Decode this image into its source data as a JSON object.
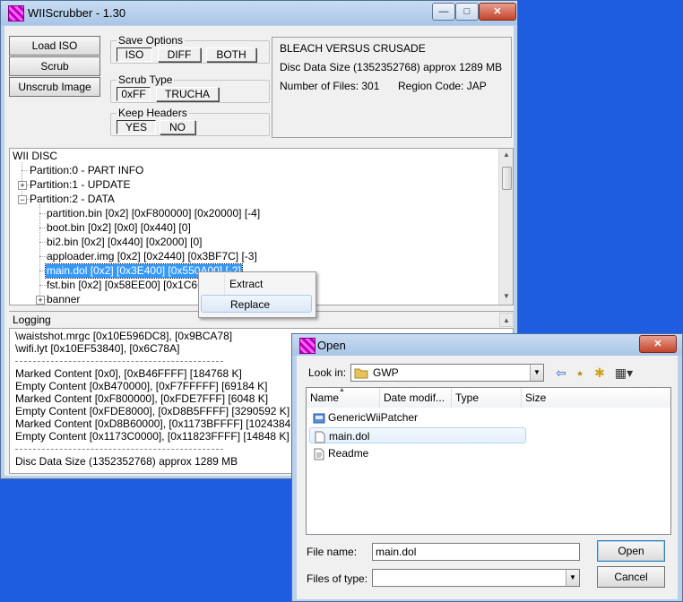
{
  "main_window": {
    "title": "WIIScrubber - 1.30",
    "buttons": {
      "load_iso": "Load ISO",
      "scrub": "Scrub",
      "unscrub": "Unscrub Image"
    },
    "save_options": {
      "legend": "Save Options",
      "iso": "ISO",
      "diff": "DIFF",
      "both": "BOTH",
      "selected": "ISO"
    },
    "scrub_type": {
      "legend": "Scrub Type",
      "ff": "0xFF",
      "trucha": "TRUCHA",
      "selected": "0xFF"
    },
    "keep_headers": {
      "legend": "Keep Headers",
      "yes": "YES",
      "no": "NO",
      "selected": "YES"
    },
    "info": {
      "game_title": "BLEACH VERSUS CRUSADE",
      "disc_size": "Disc Data Size (1352352768) approx  1289 MB",
      "num_files": "Number of Files: 301",
      "region": "Region Code: JAP"
    },
    "tree": {
      "root": "WII DISC",
      "items": [
        "Partition:0 - PART INFO",
        "Partition:1 - UPDATE",
        "Partition:2 - DATA",
        "partition.bin [0x2] [0xF800000] [0x20000] [-4]",
        "boot.bin [0x2] [0x0] [0x440] [0]",
        "bi2.bin [0x2] [0x440] [0x2000] [0]",
        "apploader.img [0x2] [0x2440] [0x3BF7C] [-3]",
        "main.dol [0x2] [0x3E400] [0x550A00] [-2]",
        "fst.bin [0x2] [0x58EE00] [0x1C6C] [-1]",
        "banner"
      ]
    },
    "logging": {
      "label": "Logging",
      "lines": [
        "\\waistshot.mrgc [0x10E596DC8], [0x9BCA78]",
        "\\wifi.lyt [0x10EF53840], [0x6C78A]",
        "Marked Content [0x0], [0xB46FFFF] [184768 K]",
        "Empty Content [0xB470000], [0xF7FFFFF] [69184 K]",
        "Marked Content [0xF800000], [0xFDE7FFF] [6048 K]",
        "Empty Content [0xFDE8000], [0xD8B5FFFF] [3290592 K]",
        "Marked Content [0xD8B60000], [0x1173BFFFF] [1024384 K]",
        "Empty Content [0x1173C0000], [0x11823FFFF] [14848 K]",
        "Disc Data Size (1352352768) approx  1289 MB"
      ]
    }
  },
  "context_menu": {
    "items": [
      "Extract",
      "Replace"
    ],
    "highlighted": "Replace"
  },
  "open_dialog": {
    "title": "Open",
    "look_in_label": "Look in:",
    "look_in_value": "GWP",
    "columns": [
      "Name",
      "Date modif...",
      "Type",
      "Size"
    ],
    "files": [
      {
        "name": "GenericWiiPatcher",
        "icon": "application-icon"
      },
      {
        "name": "main.dol",
        "icon": "file-icon"
      },
      {
        "name": "Readme",
        "icon": "text-file-icon"
      }
    ],
    "file_name_label": "File name:",
    "file_name_value": "main.dol",
    "files_of_type_label": "Files of type:",
    "files_of_type_value": "",
    "open_button": "Open",
    "cancel_button": "Cancel"
  },
  "colors": {
    "desktop": "#1e5ce0",
    "selection": "#3399ff",
    "frame": "#b9d1ea"
  }
}
